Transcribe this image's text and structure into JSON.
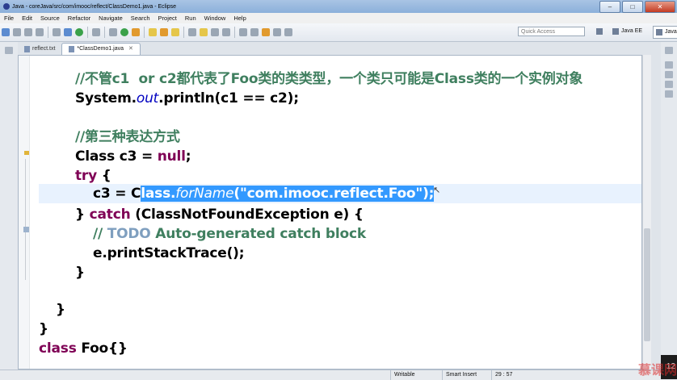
{
  "window": {
    "title": "Java - coreJava/src/com/imooc/reflect/ClassDemo1.java - Eclipse",
    "min": "–",
    "max": "□",
    "close": "✕"
  },
  "menu": [
    "File",
    "Edit",
    "Source",
    "Refactor",
    "Navigate",
    "Search",
    "Project",
    "Run",
    "Window",
    "Help"
  ],
  "toolbar": {
    "quick_access_placeholder": "Quick Access",
    "perspectives": [
      "Java EE",
      "Java"
    ]
  },
  "tabs": [
    {
      "label": "reflect.txt",
      "active": false
    },
    {
      "label": "*ClassDemo1.java",
      "active": true,
      "close": "✕"
    }
  ],
  "code": {
    "l1": "//不管c1  or c2都代表了Foo类的类类型，一个类只可能是Class类的一个实例对象",
    "l2_a": "System.",
    "l2_b": "out",
    "l2_c": ".println(c1 == c2);",
    "l3": "//第三种表达方式",
    "l4_a": "Class c3 = ",
    "l4_b": "null",
    "l4_c": ";",
    "l5_a": "try",
    "l5_b": " {",
    "l6_a": "c3 = C",
    "l6_b": "lass.",
    "l6_c": "forName",
    "l6_d": "(",
    "l6_e": "\"com.imooc.reflect.Foo\"",
    "l6_f": ");",
    "l7_a": "} ",
    "l7_b": "catch",
    "l7_c": " (ClassNotFoundException e) {",
    "l8_a": "// ",
    "l8_b": "TODO",
    "l8_c": " Auto-generated catch block",
    "l9": "e.printStackTrace();",
    "l10": "}",
    "l11": "}",
    "l12": "}",
    "l13_a": "class",
    "l13_b": " Foo{}"
  },
  "status": {
    "writable": "Writable",
    "insert_mode": "Smart Insert",
    "position": "29 : 57"
  },
  "overlay": {
    "page_number": "12",
    "watermark": "慕课网"
  }
}
